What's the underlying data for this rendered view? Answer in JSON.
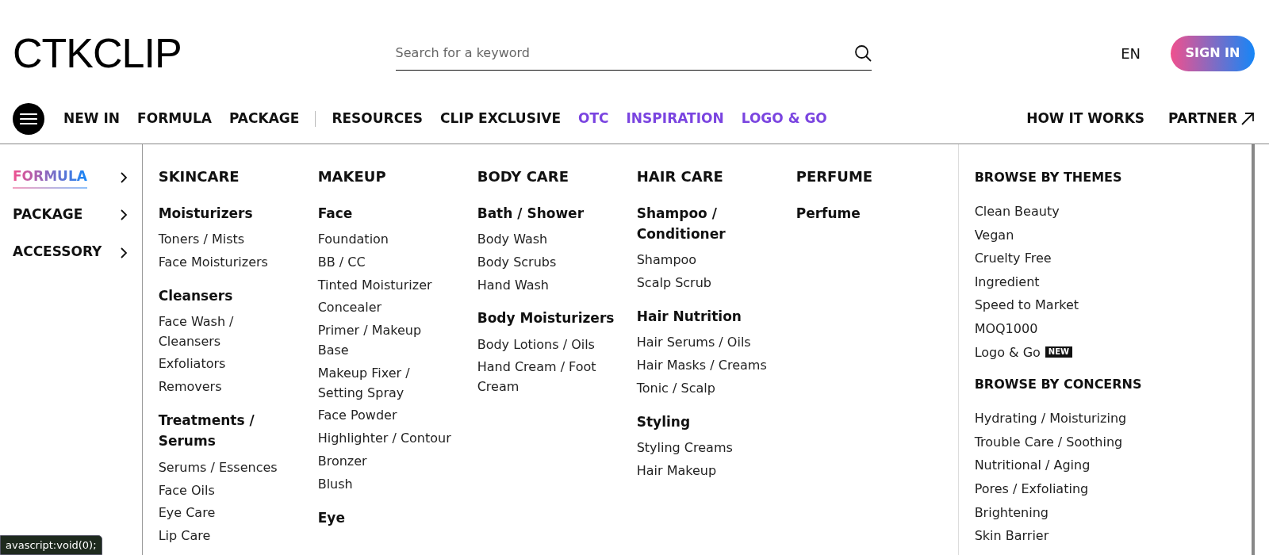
{
  "header": {
    "logo": "CTKCLIP",
    "search": {
      "placeholder": "Search for a keyword"
    },
    "language": "EN",
    "sign_in": "SIGN IN"
  },
  "nav": {
    "left_groups": [
      [
        {
          "label": "NEW IN",
          "highlighted": false
        },
        {
          "label": "FORMULA",
          "highlighted": false
        },
        {
          "label": "PACKAGE",
          "highlighted": false
        }
      ],
      [
        {
          "label": "RESOURCES",
          "highlighted": false
        },
        {
          "label": "CLIP EXCLUSIVE",
          "highlighted": false
        },
        {
          "label": "OTC",
          "highlighted": true
        },
        {
          "label": "INSPIRATION",
          "highlighted": true
        },
        {
          "label": "LOGO & GO",
          "highlighted": true
        }
      ]
    ],
    "right": [
      {
        "label": "HOW IT WORKS",
        "external": false
      },
      {
        "label": "PARTNER",
        "external": true
      }
    ]
  },
  "sidebar": {
    "items": [
      {
        "label": "FORMULA",
        "selected": true
      },
      {
        "label": "PACKAGE",
        "selected": false
      },
      {
        "label": "ACCESSORY",
        "selected": false
      }
    ]
  },
  "columns": [
    {
      "heading": "SKINCARE",
      "groups": [
        {
          "title": "Moisturizers",
          "items": [
            "Toners / Mists",
            "Face Moisturizers"
          ]
        },
        {
          "title": "Cleansers",
          "items": [
            "Face Wash / Cleansers",
            "Exfoliators",
            "Removers"
          ]
        },
        {
          "title": "Treatments / Serums",
          "items": [
            "Serums / Essences",
            "Face Oils",
            "Eye Care",
            "Lip Care"
          ]
        }
      ]
    },
    {
      "heading": "MAKEUP",
      "groups": [
        {
          "title": "Face",
          "items": [
            "Foundation",
            "BB / CC",
            "Tinted Moisturizer",
            "Concealer",
            "Primer / Makeup Base",
            "Makeup Fixer / Setting Spray",
            "Face Powder",
            "Highlighter / Contour",
            "Bronzer",
            "Blush"
          ]
        },
        {
          "title": "Eye"
        }
      ]
    },
    {
      "heading": "BODY CARE",
      "groups": [
        {
          "title": "Bath / Shower",
          "items": [
            "Body Wash",
            "Body Scrubs",
            "Hand Wash"
          ]
        },
        {
          "title": "Body Moisturizers",
          "items": [
            "Body Lotions / Oils",
            "Hand Cream / Foot Cream"
          ]
        }
      ]
    },
    {
      "heading": "HAIR CARE",
      "groups": [
        {
          "title": "Shampoo / Conditioner",
          "items": [
            "Shampoo",
            "Scalp Scrub"
          ]
        },
        {
          "title": "Hair Nutrition",
          "items": [
            "Hair Serums / Oils",
            "Hair Masks / Creams",
            "Tonic / Scalp"
          ]
        },
        {
          "title": "Styling",
          "items": [
            "Styling Creams",
            "Hair Makeup"
          ]
        }
      ]
    },
    {
      "heading": "PERFUME",
      "groups": [
        {
          "title": "Perfume"
        }
      ]
    }
  ],
  "browse": [
    {
      "heading": "BROWSE BY THEMES",
      "items": [
        {
          "label": "Clean Beauty"
        },
        {
          "label": "Vegan"
        },
        {
          "label": "Cruelty Free"
        },
        {
          "label": "Ingredient"
        },
        {
          "label": "Speed to Market"
        },
        {
          "label": "MOQ1000"
        },
        {
          "label": "Logo & Go",
          "badge": "NEW"
        }
      ]
    },
    {
      "heading": "BROWSE BY CONCERNS",
      "items": [
        {
          "label": "Hydrating / Moisturizing"
        },
        {
          "label": "Trouble Care / Soothing"
        },
        {
          "label": "Nutritional / Aging"
        },
        {
          "label": "Pores / Exfoliating"
        },
        {
          "label": "Brightening"
        },
        {
          "label": "Skin Barrier"
        }
      ]
    }
  ],
  "status_bar": "avascript:void(0);"
}
